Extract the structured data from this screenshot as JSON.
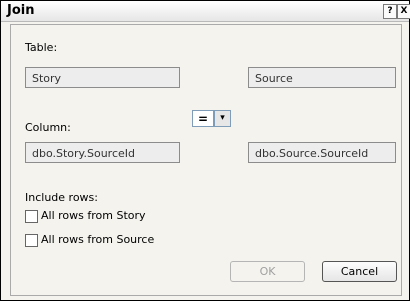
{
  "window": {
    "title": "Join",
    "help_button": "?",
    "close_button": "X"
  },
  "table_section": {
    "label": "Table:",
    "left_table": "Story",
    "right_table": "Source"
  },
  "column_section": {
    "label": "Column:",
    "operator": "=",
    "operator_arrow": "▾",
    "left_column": "dbo.Story.SourceId",
    "right_column": "dbo.Source.SourceId"
  },
  "include_rows": {
    "label": "Include rows:",
    "options": [
      {
        "label": "All rows from Story",
        "checked": false
      },
      {
        "label": "All rows from Source",
        "checked": false
      }
    ]
  },
  "buttons": {
    "ok": "OK",
    "cancel": "Cancel"
  }
}
